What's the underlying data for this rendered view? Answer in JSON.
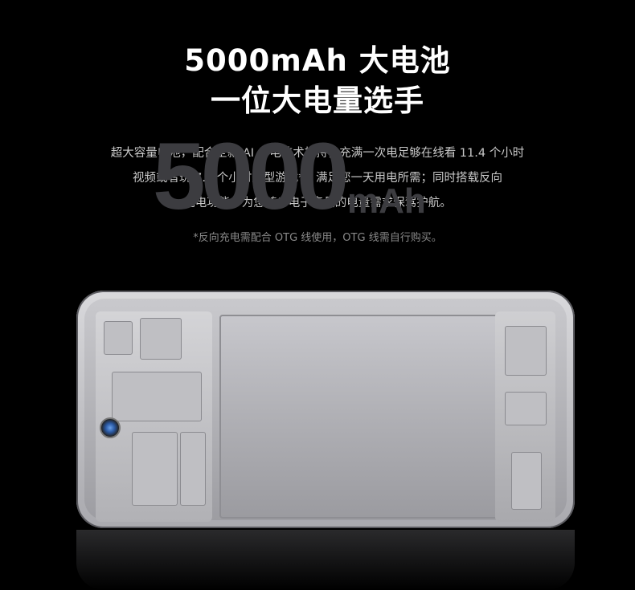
{
  "headline": {
    "line1": "5000mAh 大电池",
    "line2": "一位大电量选手"
  },
  "description": {
    "line1": "超大容量电池，配合全新 AI 省电技术加持，充满一次电足够在线看 11.4 个小时",
    "line2": "视频或者玩 7.6 个小时大型游戏*，满足您一天用电所需；同时搭载反向",
    "line3": "充电功能，为您随身电子产品的电量需求保驾护航。"
  },
  "note": "*反向充电需配合 OTG 线使用，OTG 线需自行购买。",
  "battery_label": {
    "number": "5000",
    "unit": "mAh"
  }
}
